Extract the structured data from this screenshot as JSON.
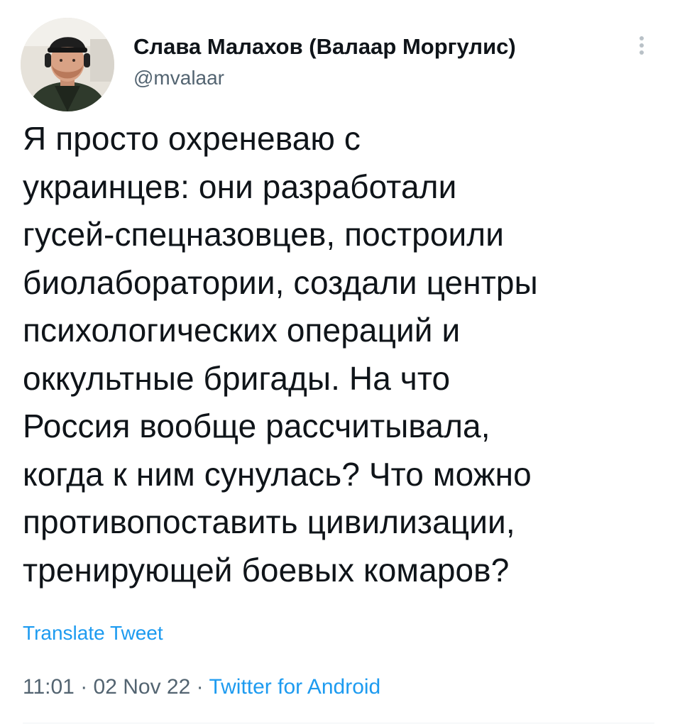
{
  "tweet": {
    "author": {
      "name": "Слава Малахов (Валаар Моргулис)",
      "handle": "@mvalaar",
      "avatar_icon": "user-photo-avatar"
    },
    "more_icon": "vertical-ellipsis-icon",
    "text": "Я просто охреневаю с\nукраинцев: они разработали\nгусей-спецназовцев, построили\nбиолаборатории, создали центры\nпсихологических операций и\nоккультные бригады. На что\nРоссия вообще рассчитывала,\nкогда к ним сунулась? Что можно\nпротивопоставить цивилизации,\nтренирующей боевых комаров?",
    "translate_label": "Translate Tweet",
    "time": "11:01",
    "date": "02 Nov 22",
    "separator": "·",
    "source": "Twitter for Android"
  },
  "colors": {
    "text": "#0f1419",
    "secondary": "#536471",
    "link": "#1d9bf0",
    "divider": "#eff3f4"
  }
}
